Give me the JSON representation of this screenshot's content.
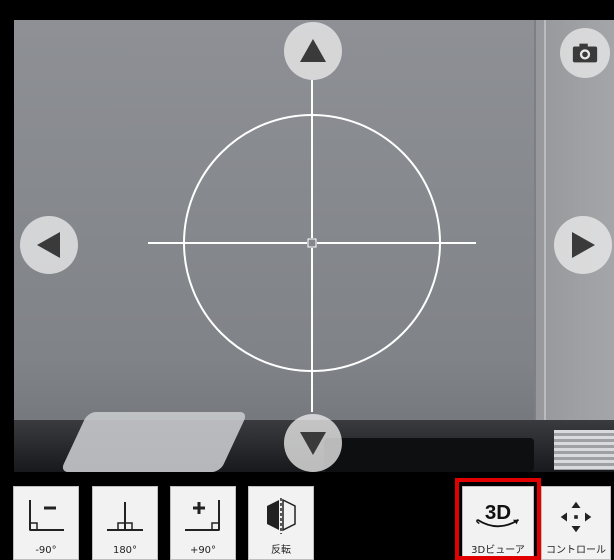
{
  "camera": {
    "icon": "camera-icon",
    "crosshair": "crosshair-reticle"
  },
  "nav": {
    "up_icon": "arrow-up-icon",
    "down_icon": "arrow-down-icon",
    "left_icon": "arrow-left-icon",
    "right_icon": "arrow-right-icon"
  },
  "toolbar": {
    "rotate_minus90_label": "-90°",
    "rotate_180_label": "180°",
    "rotate_plus90_label": "+90°",
    "flip_label": "反転",
    "viewer3d_label": "3Dビューア",
    "viewer3d_icon_text": "3D",
    "control_label": "コントロール"
  },
  "colors": {
    "highlight": "#e00000",
    "button_bg": "#f2f2f2",
    "overlay_line": "#ffffff"
  }
}
